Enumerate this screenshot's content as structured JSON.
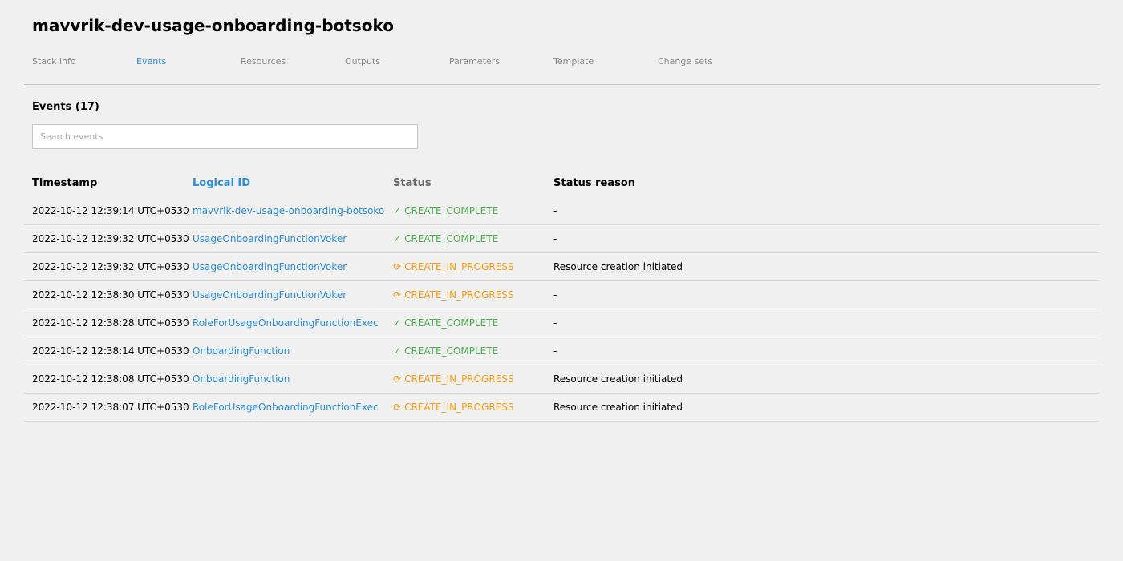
{
  "page": {
    "title": "mavvrik-dev-usage-onboarding-botsoko"
  },
  "tabs": [
    {
      "label": "Stack info",
      "active": false
    },
    {
      "label": "Events",
      "active": true
    },
    {
      "label": "Resources",
      "active": false
    },
    {
      "label": "Outputs",
      "active": false
    },
    {
      "label": "Parameters",
      "active": false
    },
    {
      "label": "Template",
      "active": false
    },
    {
      "label": "Change sets",
      "active": false
    }
  ],
  "events": {
    "title": "Events (17)",
    "search_placeholder": "Search events",
    "search_value": "",
    "columns": [
      "Timestamp",
      "Logical ID",
      "Status",
      "Status reason"
    ],
    "rows": [
      {
        "timestamp": "2022-10-12 12:39:14 UTC+0530",
        "logical_id": "mavvrik-dev-usage-onboarding-botsoko",
        "status_icon": "✓",
        "status": "CREATE_COMPLETE",
        "reason": "-"
      },
      {
        "timestamp": "2022-10-12 12:39:32 UTC+0530",
        "logical_id": "UsageOnboardingFunctionVoker",
        "status_icon": "✓",
        "status": "CREATE_COMPLETE",
        "reason": "-"
      },
      {
        "timestamp": "2022-10-12 12:39:32 UTC+0530",
        "logical_id": "UsageOnboardingFunctionVoker",
        "status_icon": "⟳",
        "status": "CREATE_IN_PROGRESS",
        "reason": "Resource creation initiated"
      },
      {
        "timestamp": "2022-10-12 12:38:30 UTC+0530",
        "logical_id": "UsageOnboardingFunctionVoker",
        "status_icon": "⟳",
        "status": "CREATE_IN_PROGRESS",
        "reason": "-"
      },
      {
        "timestamp": "2022-10-12 12:38:28 UTC+0530",
        "logical_id": "RoleForUsageOnboardingFunctionExec",
        "status_icon": "✓",
        "status": "CREATE_COMPLETE",
        "reason": "-"
      },
      {
        "timestamp": "2022-10-12 12:38:14 UTC+0530",
        "logical_id": "OnboardingFunction",
        "status_icon": "✓",
        "status": "CREATE_COMPLETE",
        "reason": "-"
      },
      {
        "timestamp": "2022-10-12 12:38:08 UTC+0530",
        "logical_id": "OnboardingFunction",
        "status_icon": "⟳",
        "status": "CREATE_IN_PROGRESS",
        "reason": "Resource creation initiated"
      },
      {
        "timestamp": "2022-10-12 12:38:07 UTC+0530",
        "logical_id": "RoleForUsageOnboardingFunctionExec",
        "status_icon": "⟳",
        "status": "CREATE_IN_PROGRESS",
        "reason": "Resource creation initiated"
      }
    ]
  },
  "colors": {
    "link": "#2a8fd8",
    "complete": "#4caf50",
    "in_progress": "#f39c12",
    "tab_inactive": "#8a8a8a"
  },
  "icons": {
    "complete": "check-icon",
    "in_progress": "spinner-icon"
  }
}
